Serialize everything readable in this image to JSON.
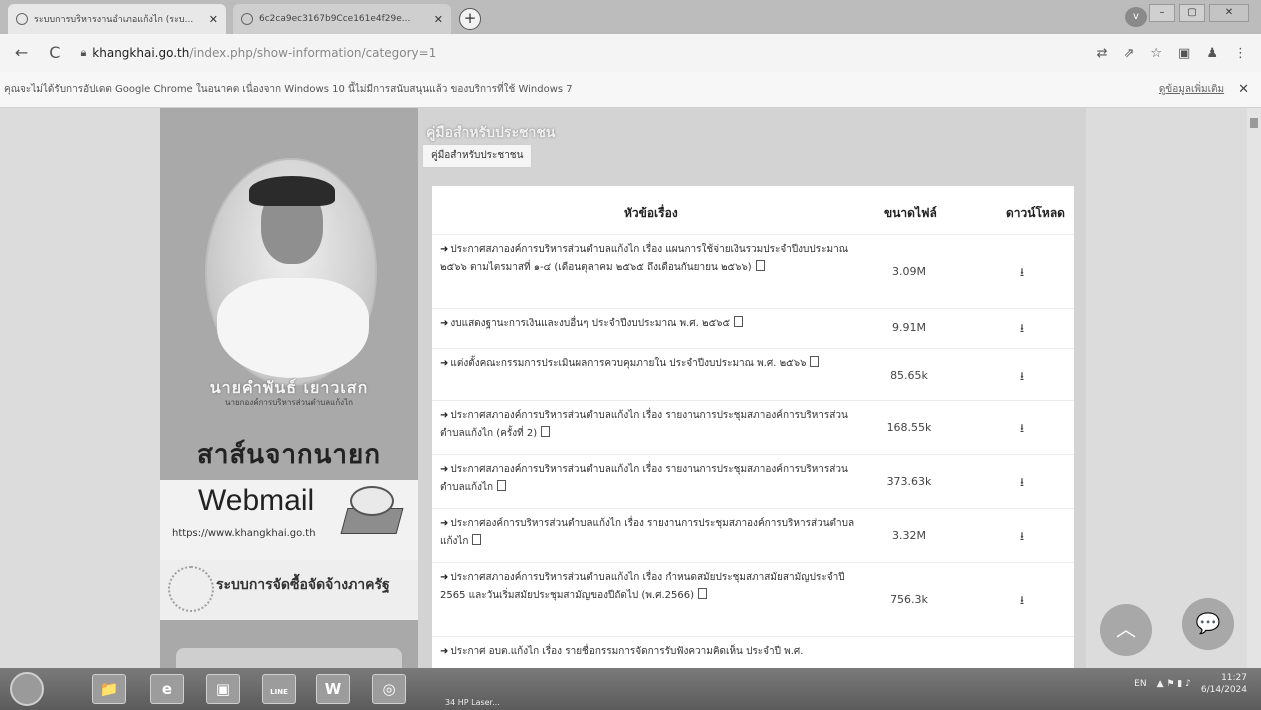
{
  "browser": {
    "tabs": [
      {
        "title": "ระบบการบริหารงานอำเภอแก้งไก (ระบ...",
        "active": true
      },
      {
        "title": "6c2ca9ec3167b9Cce161e4f29e...",
        "active": false
      }
    ],
    "new_tab": "+",
    "profile": "v",
    "window_controls": [
      "–",
      "▢",
      "✕"
    ],
    "nav": {
      "back": "←",
      "reload": "C"
    },
    "url_host": "khangkhai.go.th",
    "url_path": "/index.php/show-information/category=1",
    "toolbar_icons": [
      "⇄",
      "⇗",
      "☆",
      "▣",
      "♟",
      "⋮"
    ]
  },
  "infobar": {
    "message": "คุณจะไม่ได้รับการอัปเดต Google Chrome ในอนาคต เนื่องจาก Windows 10 นี้ไม่มีการสนับสนุนแล้ว ของบริการที่ใช้ Windows 7",
    "learn_more": "ดูข้อมูลเพิ่มเติม",
    "close": "✕"
  },
  "sidebar": {
    "person_name": "นายคำพันธ์ เยาวเสก",
    "person_title": "นายกองค์การบริหารส่วนตำบลแก้งไก",
    "speech_heading": "สาส์นจากนายก",
    "webmail_title": "Webmail",
    "webmail_url": "https://www.khangkhai.go.th",
    "procurement": "ระบบการจัดซื้อจัดจ้างภาครัฐ"
  },
  "content": {
    "section_heading": "คู่มือสำหรับประชาชน",
    "section_crumb": "คู่มือสำหรับประชาชน",
    "columns": {
      "title": "หัวข้อเรื่อง",
      "size": "ขนาดไฟล์",
      "download": "ดาวน์โหลด"
    },
    "rows": [
      {
        "title": "ประกาศสภาองค์การบริหารส่วนตำบลแก้งไก เรื่อง แผนการใช้จ่ายเงินรวมประจำปีงบประมาณ ๒๕๖๖ ตามไตรมาสที่ ๑-๔ (เดือนตุลาคม ๒๕๖๕ ถึงเดือนกันยายน ๒๕๖๖)",
        "size": "3.09M",
        "dl": "⭳"
      },
      {
        "title": "งบแสดงฐานะการเงินและงบอื่นๆ ประจำปีงบประมาณ พ.ศ. ๒๕๖๕",
        "size": "9.91M",
        "dl": "⭳"
      },
      {
        "title": "แต่งตั้งคณะกรรมการประเมินผลการควบคุมภายใน ประจำปีงบประมาณ พ.ศ. ๒๕๖๖",
        "size": "85.65k",
        "dl": "⭳"
      },
      {
        "title": "ประกาศสภาองค์การบริหารส่วนตำบลแก้งไก เรื่อง รายงานการประชุมสภาองค์การบริหารส่วนตำบลแก้งไก (ครั้งที่ 2)",
        "size": "168.55k",
        "dl": "⭳"
      },
      {
        "title": "ประกาศสภาองค์การบริหารส่วนตำบลแก้งไก เรื่อง รายงานการประชุมสภาองค์การบริหารส่วนตำบลแก้งไก",
        "size": "373.63k",
        "dl": "⭳"
      },
      {
        "title": "ประกาศองค์การบริหารส่วนตำบลแก้งไก เรื่อง รายงานการประชุมสภาองค์การบริหารส่วนตำบลแก้งไก",
        "size": "3.32M",
        "dl": "⭳"
      },
      {
        "title": "ประกาศสภาองค์การบริหารส่วนตำบลแก้งไก เรื่อง กำหนดสมัยประชุมสภาสมัยสามัญประจำปี 2565 และวันเริ่มสมัยประชุมสามัญของปีถัดไป (พ.ศ.2566)",
        "size": "756.3k",
        "dl": "⭳"
      },
      {
        "title": "ประกาศ อบต.แก้งไก เรื่อง รายชื่อกรรมการจัดการรับฟังความคิดเห็น ประจำปี พ.ศ.",
        "size": "",
        "dl": ""
      }
    ]
  },
  "fabs": {
    "up": "︿",
    "chat": "💬"
  },
  "taskbar": {
    "apps": [
      "📁",
      "e",
      "▣",
      "◉",
      "W",
      "◎"
    ],
    "line_label": "LINE",
    "active_label": "34 HP Laser...",
    "lang": "EN",
    "time": "11:27",
    "date": "6/14/2024"
  }
}
